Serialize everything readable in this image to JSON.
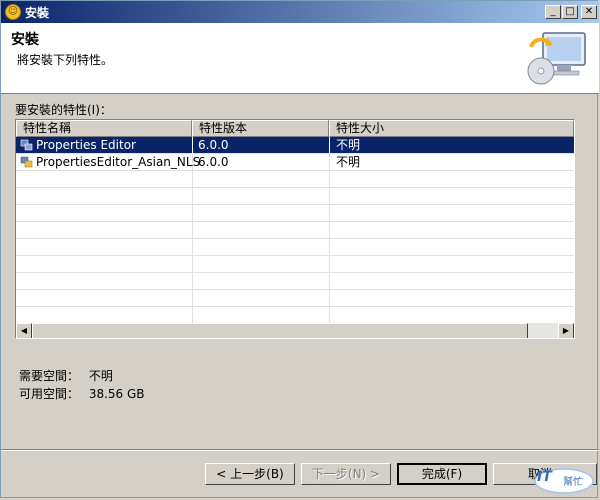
{
  "window": {
    "title": "安裝"
  },
  "header": {
    "title": "安裝",
    "description": "將安裝下列特性。"
  },
  "features": {
    "label": "要安裝的特性(I)：",
    "columns": [
      "特性名稱",
      "特性版本",
      "特性大小"
    ],
    "rows": [
      {
        "name": "Properties Editor",
        "version": "6.0.0",
        "size": "不明",
        "selected": true
      },
      {
        "name": "PropertiesEditor_Asian_NLS",
        "version": "6.0.0",
        "size": "不明",
        "selected": false
      }
    ]
  },
  "space": {
    "required_label": "需要空間：",
    "required_value": "不明",
    "available_label": "可用空間：",
    "available_value": "38.56 GB"
  },
  "buttons": {
    "back": "< 上一步(B)",
    "next": "下一步(N) >",
    "finish": "完成(F)",
    "cancel": "取消"
  },
  "watermark": {
    "logo": "IT",
    "sub": "幫忙"
  },
  "colors": {
    "selection": "#0a246a",
    "titlebar_start": "#0a246a",
    "titlebar_end": "#a6caf0"
  },
  "icons": {
    "app": "eclipse-icon",
    "install": "install-wizard-icon",
    "feature": "feature-plugin-icon"
  }
}
